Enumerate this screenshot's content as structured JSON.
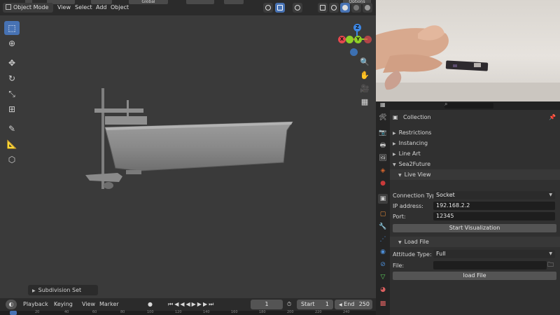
{
  "header": {
    "orientation_label": "Global",
    "options_label": "Options",
    "mode_label": "Object Mode",
    "menus": [
      "View",
      "Select",
      "Add",
      "Object"
    ]
  },
  "viewport": {
    "gizmo_axes": {
      "x": "X",
      "y": "Y",
      "z": "Z"
    },
    "subdivision_panel": "Subdivision Set"
  },
  "timeline": {
    "menus": [
      "Playback",
      "Keying",
      "View",
      "Marker"
    ],
    "current_frame": "1",
    "start_label": "Start",
    "start_value": "1",
    "end_label": "End",
    "end_value": "250",
    "ruler_ticks": [
      "20",
      "40",
      "60",
      "80",
      "100",
      "120",
      "140",
      "160",
      "180",
      "200",
      "220",
      "240"
    ]
  },
  "properties": {
    "collection_title": "Collection",
    "sections": [
      "Restrictions",
      "Instancing",
      "Line Art",
      "Sea2Future"
    ],
    "live_view": {
      "title": "Live View",
      "connection_type_label": "Connection Type:",
      "connection_type_value": "Socket",
      "ip_label": "IP address:",
      "ip_value": "192.168.2.2",
      "port_label": "Port:",
      "port_value": "12345",
      "start_button": "Start Visualization"
    },
    "load_file": {
      "title": "Load File",
      "attitude_label": "Attitude Type:",
      "attitude_value": "Full",
      "file_label": "File:",
      "file_value": "",
      "load_button": "load File"
    }
  },
  "colors": {
    "accent": "#4772b3",
    "axis_x": "#e5484d",
    "axis_y": "#8fcf27",
    "axis_z": "#3d87e5"
  }
}
